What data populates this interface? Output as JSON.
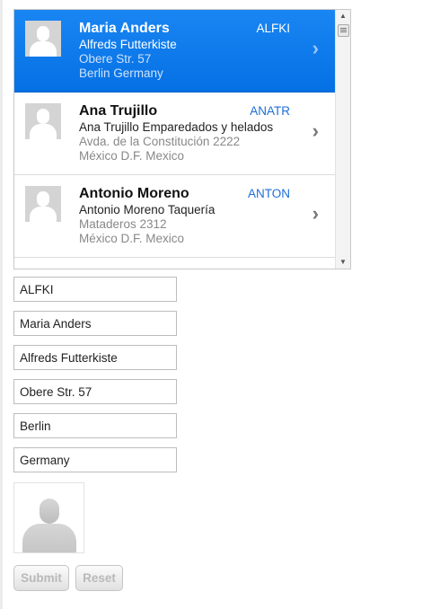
{
  "customers": [
    {
      "id": "ALFKI",
      "name": "Maria Anders",
      "company": "Alfreds Futterkiste",
      "address": "Obere Str. 57",
      "city_country": "Berlin Germany",
      "selected": true
    },
    {
      "id": "ANATR",
      "name": "Ana Trujillo",
      "company": "Ana Trujillo Emparedados y helados",
      "address": "Avda. de la Constitución 2222",
      "city_country": "México D.F. Mexico",
      "selected": false
    },
    {
      "id": "ANTON",
      "name": "Antonio Moreno",
      "company": "Antonio Moreno Taquería",
      "address": "Mataderos 2312",
      "city_country": "México D.F. Mexico",
      "selected": false
    }
  ],
  "form": {
    "id": "ALFKI",
    "name": "Maria Anders",
    "company": "Alfreds Futterkiste",
    "address": "Obere Str. 57",
    "city": "Berlin",
    "country": "Germany"
  },
  "buttons": {
    "submit": "Submit",
    "reset": "Reset"
  },
  "icons": {
    "list_avatar": "person-placeholder-icon",
    "chevron": "chevron-right-icon",
    "photo": "person-placeholder-icon"
  },
  "colors": {
    "selected_row": "#0a7ef2",
    "id_text": "#1d6fd6"
  }
}
